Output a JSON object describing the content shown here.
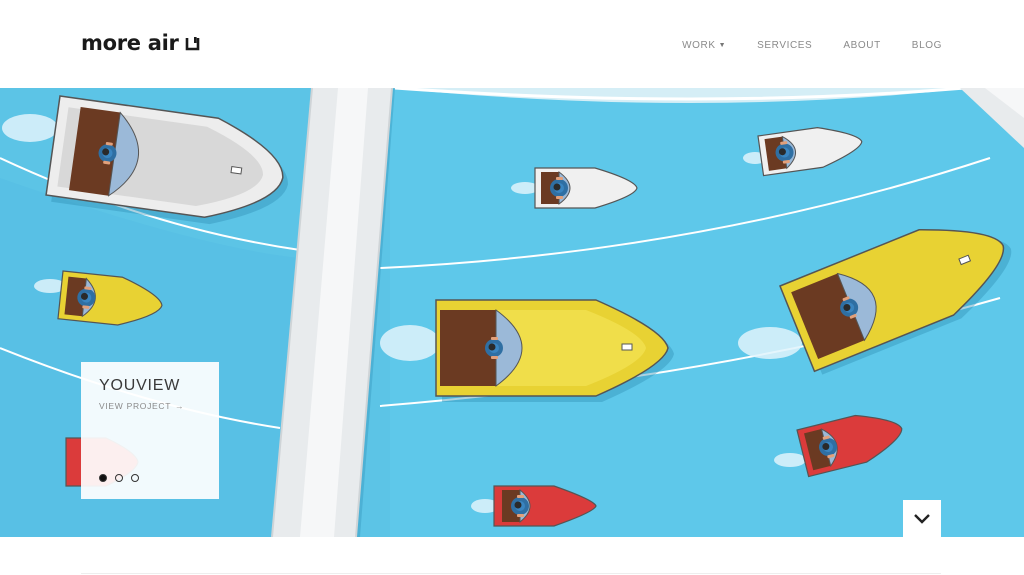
{
  "brand": {
    "name": "more air",
    "icon": "cup-icon"
  },
  "nav": {
    "items": [
      {
        "label": "WORK",
        "has_dropdown": true
      },
      {
        "label": "SERVICES",
        "has_dropdown": false
      },
      {
        "label": "ABOUT",
        "has_dropdown": false
      },
      {
        "label": "BLOG",
        "has_dropdown": false
      }
    ]
  },
  "hero": {
    "project_title": "YOUVIEW",
    "project_link": "VIEW PROJECT",
    "project_link_icon": "arrow-right-icon",
    "slides": {
      "total": 3,
      "active": 1
    },
    "scroll_icon": "chevron-down-icon"
  },
  "colors": {
    "water": "#5cc4e6",
    "water_dark": "#3fa9cf",
    "dock": "#e9ecee",
    "boat_yellow": "#e8d233",
    "boat_white": "#eeeeee",
    "boat_red": "#db3b3b"
  }
}
